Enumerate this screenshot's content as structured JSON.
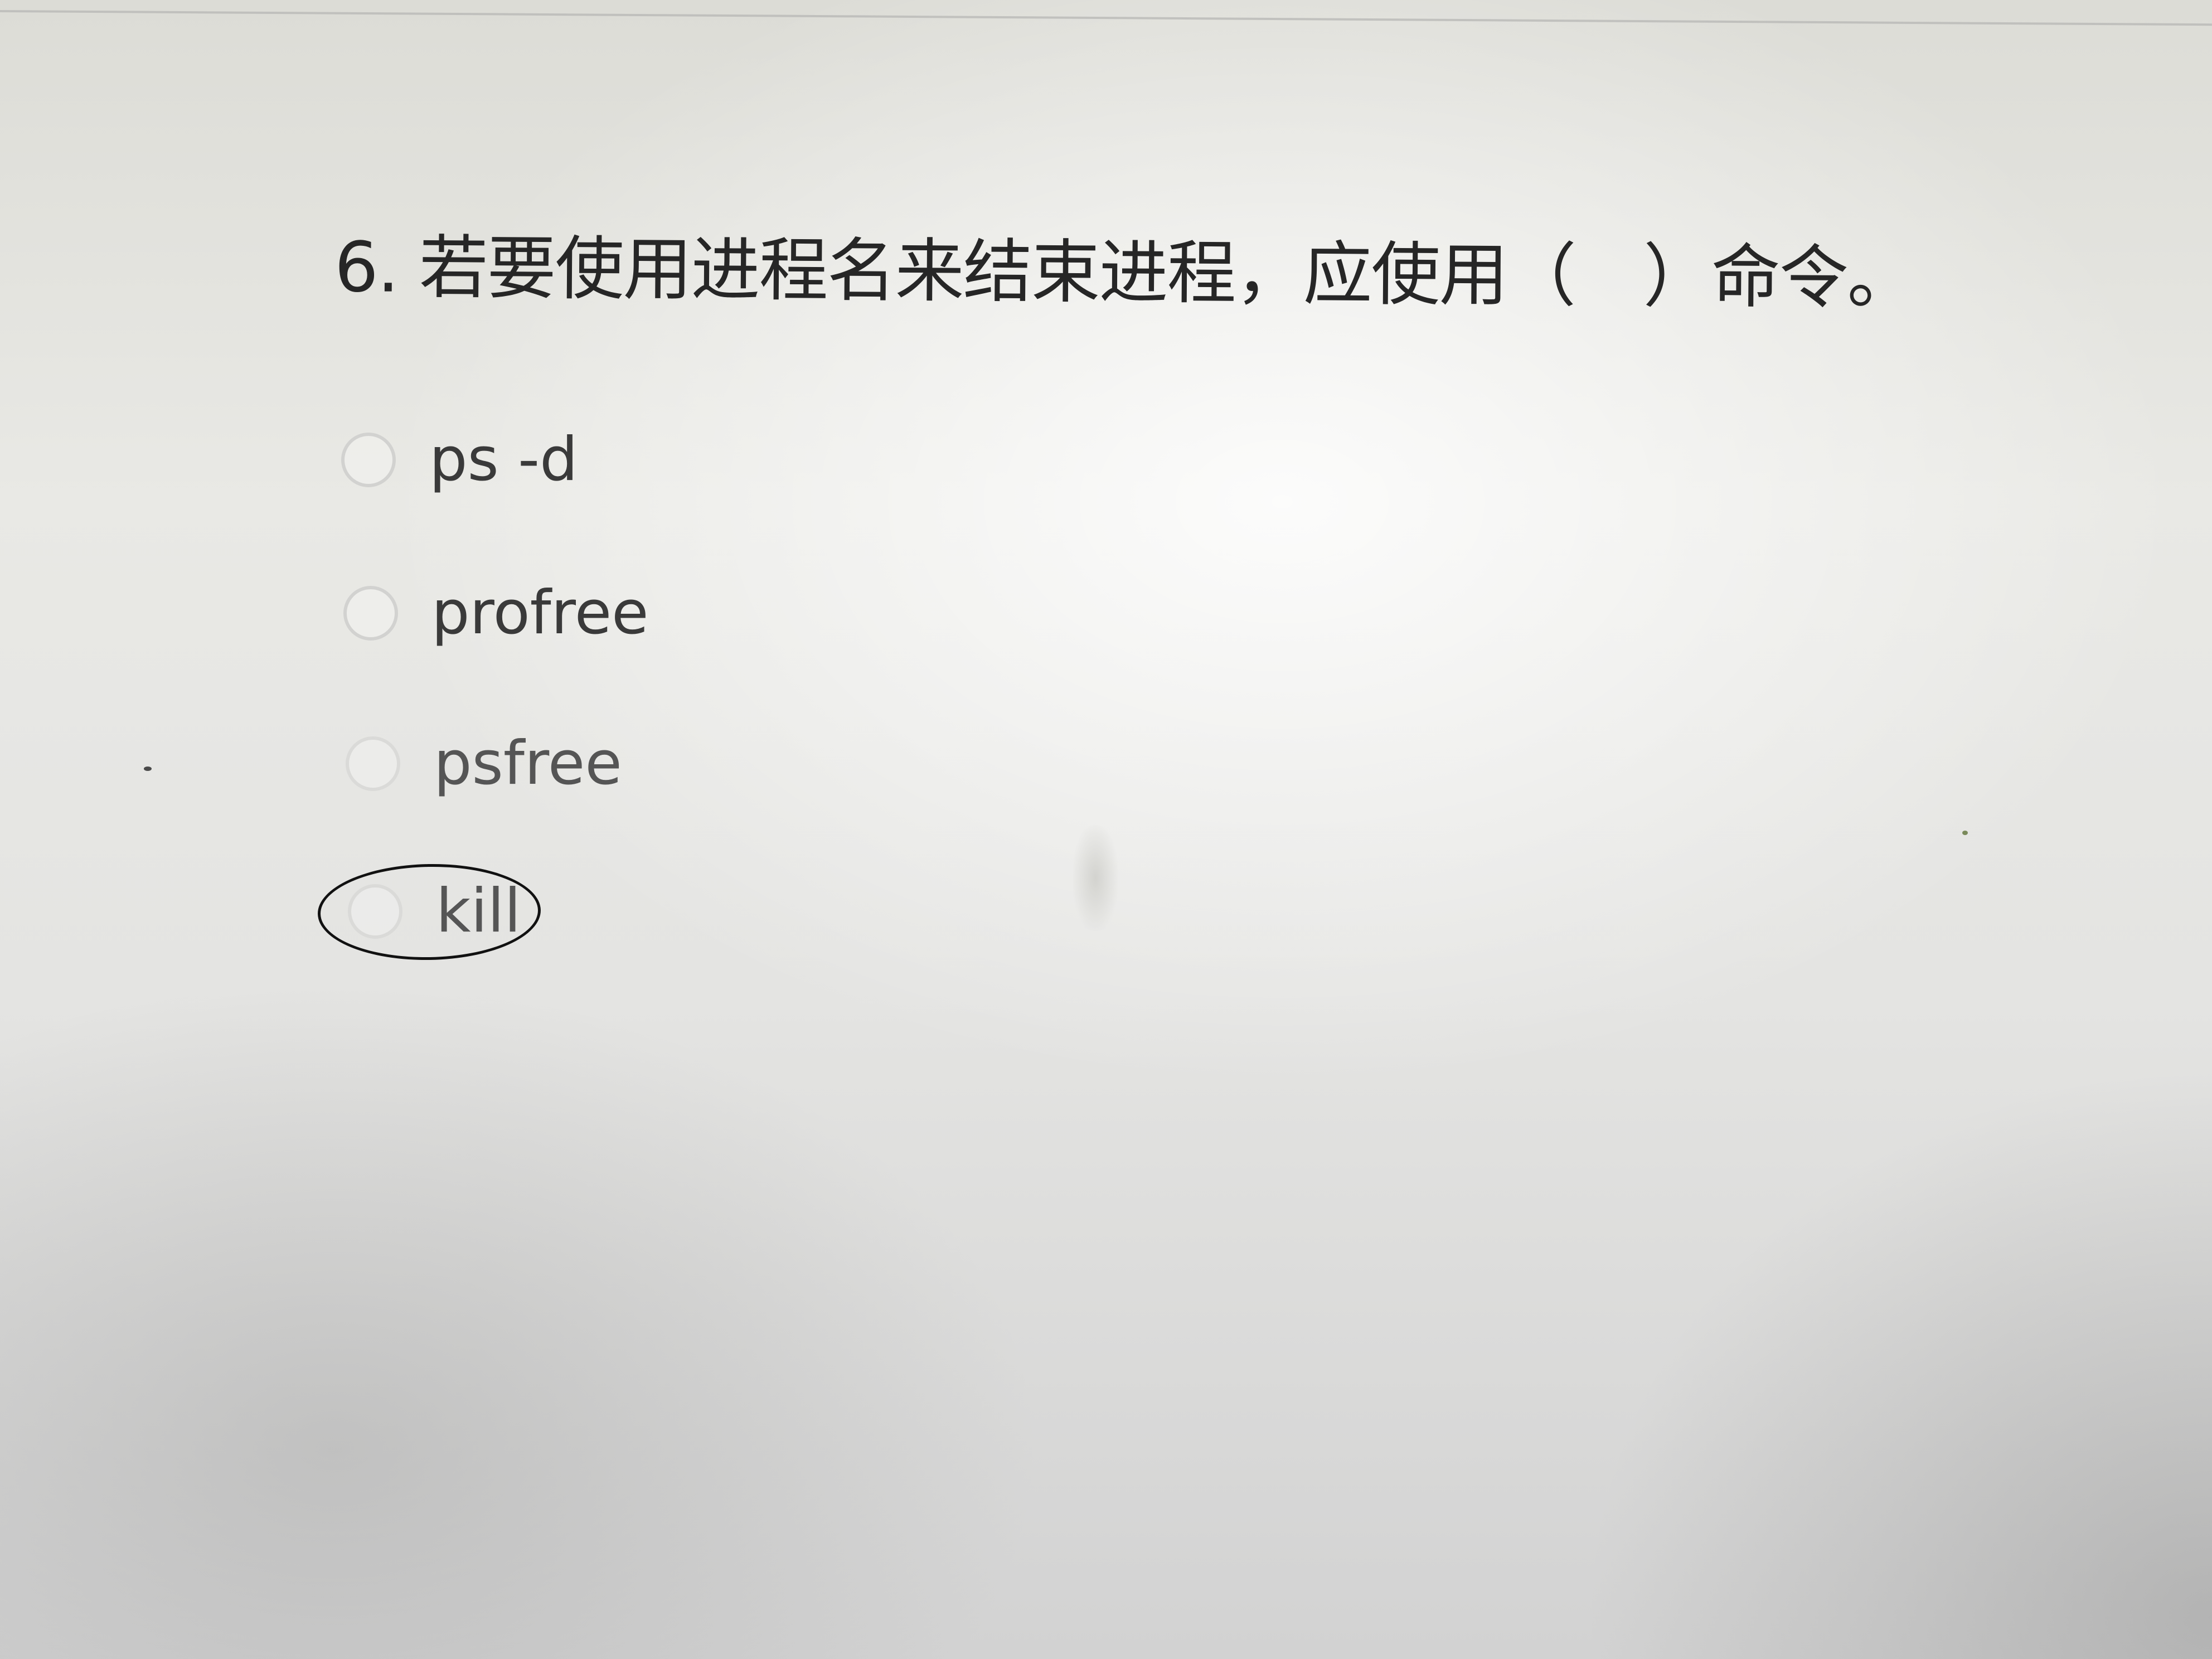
{
  "question": {
    "text": "6. 若要使用进程名来结束进程，应使用（　）命令。"
  },
  "options": [
    {
      "label": "ps -d"
    },
    {
      "label": "profree"
    },
    {
      "label": "psfree"
    },
    {
      "label": "kill"
    }
  ]
}
